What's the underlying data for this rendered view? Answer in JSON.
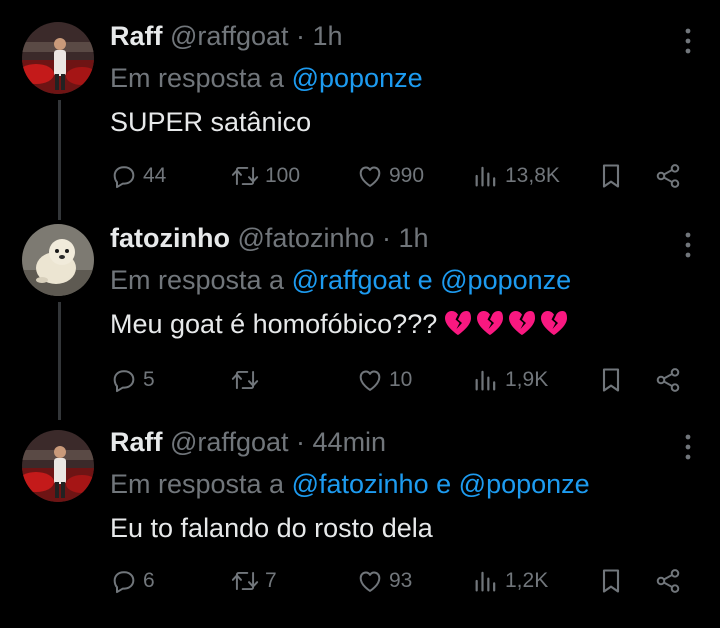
{
  "tweets": [
    {
      "display_name": "Raff",
      "handle": "@raffgoat",
      "separator": "·",
      "time": "1h",
      "reply_prefix": "Em resposta a",
      "mentions": [
        "@poponze"
      ],
      "mention_joiner": "",
      "text": "SUPER satânico",
      "emoji": [],
      "replies": "44",
      "retweets": "100",
      "likes": "990",
      "views": "13,8K",
      "avatar": "red-cars-photo-avatar"
    },
    {
      "display_name": "fatozinho",
      "handle": "@fatozinho",
      "separator": "·",
      "time": "1h",
      "reply_prefix": "Em resposta a",
      "mentions": [
        "@raffgoat",
        "@poponze"
      ],
      "mention_joiner": "e",
      "text": "Meu goat é homofóbico???",
      "emoji": [
        "broken-heart-icon",
        "broken-heart-icon",
        "broken-heart-icon",
        "broken-heart-icon"
      ],
      "replies": "5",
      "retweets": "",
      "likes": "10",
      "views": "1,9K",
      "avatar": "seal-pup-avatar"
    },
    {
      "display_name": "Raff",
      "handle": "@raffgoat",
      "separator": "·",
      "time": "44min",
      "reply_prefix": "Em resposta a",
      "mentions": [
        "@fatozinho",
        "@poponze"
      ],
      "mention_joiner": "e",
      "text": "Eu to falando do rosto dela",
      "emoji": [],
      "replies": "6",
      "retweets": "7",
      "likes": "93",
      "views": "1,2K",
      "avatar": "red-cars-photo-avatar"
    }
  ],
  "icons": {
    "reply": "reply-bubble-icon",
    "retweet": "retweet-arrows-icon",
    "like": "heart-outline-icon",
    "views": "analytics-bars-icon",
    "bookmark": "bookmark-icon",
    "share": "share-nodes-icon",
    "more": "more-dots-icon"
  },
  "colors": {
    "background": "#000000",
    "text": "#e7e9ea",
    "muted": "#71767b",
    "link": "#1d9bf0",
    "thread_line": "#333639",
    "broken_heart": "#f91880"
  }
}
